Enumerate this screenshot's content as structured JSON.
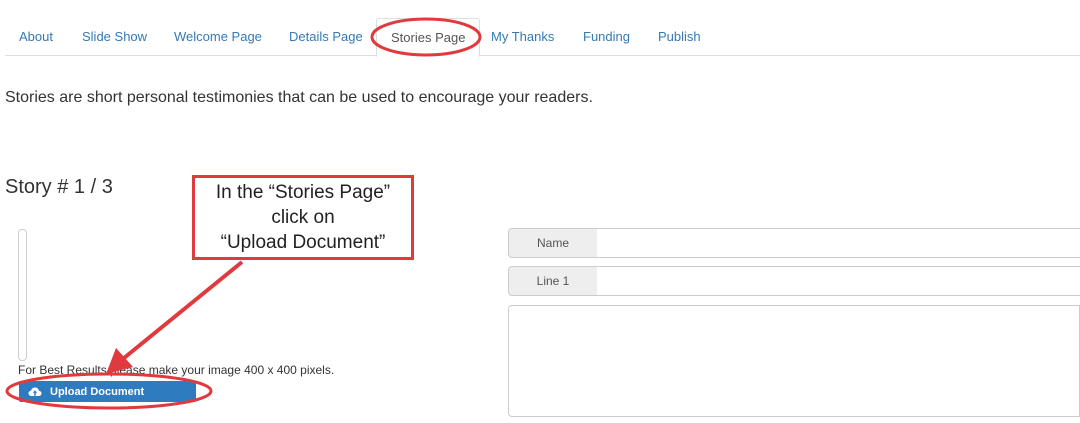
{
  "tabs": [
    {
      "label": "About"
    },
    {
      "label": "Slide Show"
    },
    {
      "label": "Welcome Page"
    },
    {
      "label": "Details Page"
    },
    {
      "label": "Stories Page",
      "active": true
    },
    {
      "label": "My Thanks"
    },
    {
      "label": "Funding"
    },
    {
      "label": "Publish"
    }
  ],
  "intro_text": "Stories are short personal testimonies that can be used to encourage your readers.",
  "story": {
    "heading": "Story # 1 / 3",
    "image_hint": "For Best Results please make your image 400 x 400 pixels.",
    "upload_label": "Upload Document",
    "upload_icon": "cloud-upload-icon"
  },
  "form": {
    "name_label": "Name",
    "name_value": "",
    "line1_label": "Line 1",
    "line1_value": "",
    "body_value": ""
  },
  "annotation": {
    "line1": "In the “Stories Page”",
    "line2": "click on",
    "line3": "“Upload Document”"
  },
  "colors": {
    "link": "#337ab7",
    "primary_button": "#2f7bbf",
    "annotation_red": "#e03a3e"
  }
}
